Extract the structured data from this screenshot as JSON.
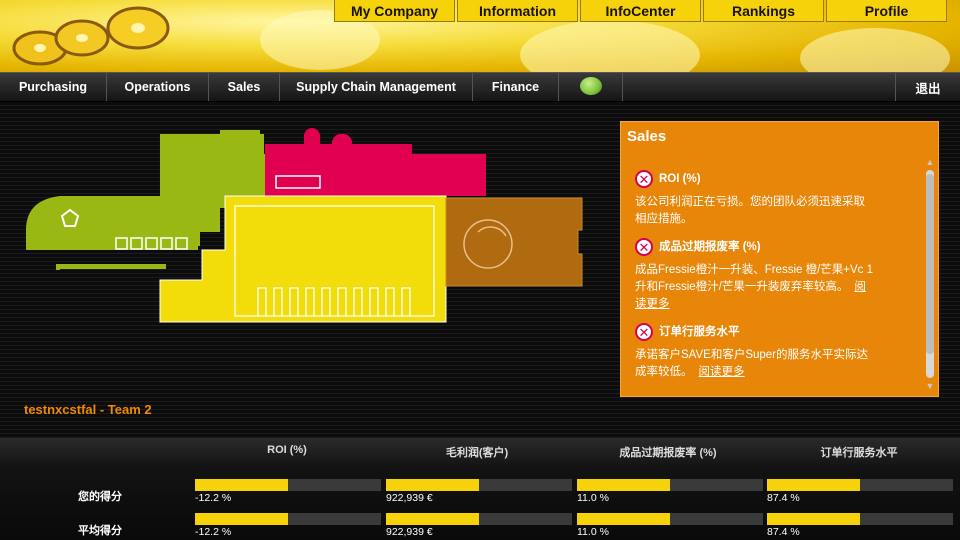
{
  "top_nav": [
    "My Company",
    "Information",
    "InfoCenter",
    "Rankings",
    "Profile"
  ],
  "main_nav": [
    "Purchasing",
    "Operations",
    "Sales",
    "Supply Chain Management",
    "Finance"
  ],
  "logout_label": "退出",
  "team_label": "testnxcstfal - Team 2",
  "panel": {
    "title": "Sales",
    "items": [
      {
        "title": "ROI (%)",
        "text": "该公司利润正在亏损。您的团队必须迅速采取相应措施。",
        "link": ""
      },
      {
        "title": "成品过期报废率 (%)",
        "text": "成品Fressie橙汁一升装、Fressie 橙/芒果+Vc 1升和Fressie橙汁/芒果一升装废弃率较高。",
        "link": "阅读更多"
      },
      {
        "title": "订单行服务水平",
        "text": "承诺客户SAVE和客户Super的服务水平实际达成率较低。",
        "link": "阅读更多"
      }
    ]
  },
  "scores": {
    "columns": [
      "ROI (%)",
      "毛利润(客户)",
      "成品过期报废率 (%)",
      "订单行服务水平"
    ],
    "rows": [
      {
        "label": "您的得分",
        "values": [
          "-12.2 %",
          "922,939 €",
          "11.0 %",
          "87.4 %"
        ],
        "fill": [
          0.5,
          0.5,
          0.5,
          0.5
        ]
      },
      {
        "label": "平均得分",
        "values": [
          "-12.2 %",
          "922,939 €",
          "11.0 %",
          "87.4 %"
        ],
        "fill": [
          0.5,
          0.5,
          0.5,
          0.5
        ]
      }
    ]
  },
  "colors": {
    "accent_orange": "#e8860a",
    "bar_yellow": "#f5d20a",
    "warehouse_green": "#9ab814",
    "office_red": "#e0004f",
    "factory_yellow": "#f2dc0a",
    "storage_brown": "#b06a10"
  },
  "icons": [
    "close-x-icon",
    "status-dot-icon",
    "scroll-up-icon",
    "scroll-down-icon"
  ]
}
